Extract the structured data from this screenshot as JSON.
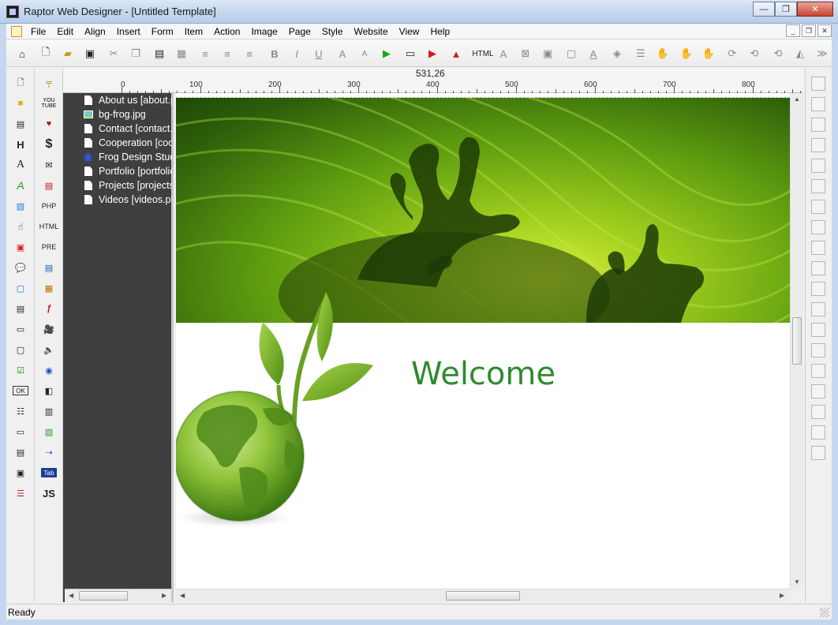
{
  "window": {
    "title": "Raptor Web Designer - [Untitled Template]",
    "minimize_glyph": "—",
    "maximize_glyph": "❐",
    "close_glyph": "✕"
  },
  "menu": {
    "items": [
      "File",
      "Edit",
      "Align",
      "Insert",
      "Form",
      "Item",
      "Action",
      "Image",
      "Page",
      "Style",
      "Website",
      "View",
      "Help"
    ],
    "mdi_minimize": "_",
    "mdi_restore": "❐",
    "mdi_close": "✕"
  },
  "toolbar": {
    "html_label": "HTML",
    "icons": [
      "new-page-icon",
      "new-template-icon",
      "open-folder-icon",
      "save-icon",
      "cut-icon",
      "copy-icon",
      "paste-icon",
      "paste-special-icon",
      "align-left-icon",
      "align-center-icon",
      "align-right-icon",
      "bold-icon",
      "italic-icon",
      "underline-icon",
      "font-grow-icon",
      "font-shrink-icon",
      "preview-icon",
      "preview-browser-icon",
      "publish-icon",
      "upload-icon",
      "html-icon",
      "font-icon",
      "grid-icon",
      "snap-icon",
      "select-icon",
      "text-color-icon",
      "fill-color-icon",
      "line-icon",
      "hand-icon",
      "hand2-icon",
      "hand3-icon",
      "rotate-icon",
      "rotate2-icon",
      "rotate3-icon",
      "flip-icon",
      "more-icon"
    ]
  },
  "palette1": {
    "icons": [
      "page-icon",
      "folder-icon",
      "form-icon",
      "heading-icon",
      "text-icon",
      "styled-text-icon",
      "image-icon",
      "hand-icon",
      "shape-icon",
      "comment-icon",
      "panel-icon",
      "frame-icon",
      "inline-frame-icon",
      "checkbox-icon",
      "ok-button-icon",
      "list-icon",
      "line-icon",
      "textarea-icon",
      "counter-icon",
      "menu-list-icon"
    ],
    "labels": {
      "heading": "H",
      "text": "A",
      "styled": "A",
      "ok": "OK"
    }
  },
  "palette2": {
    "labels": {
      "youtube": "YOU\nTUBE",
      "dollar": "$",
      "php": "PHP",
      "html": "HTML",
      "pre": "PRE",
      "tab": "Tab",
      "js": "JS"
    }
  },
  "ruler": {
    "coordinates": "531,26",
    "labels": [
      "0",
      "100",
      "200",
      "300",
      "400",
      "500",
      "600",
      "700",
      "800"
    ]
  },
  "site_tree": {
    "items": [
      {
        "label": "About us [about.php]",
        "icon": "file-icon"
      },
      {
        "label": "bg-frog.jpg",
        "icon": "image-file-icon"
      },
      {
        "label": "Contact [contact.php]",
        "icon": "file-icon"
      },
      {
        "label": "Cooperation [cooperation.php]",
        "icon": "file-icon"
      },
      {
        "label": "Frog Design Studio",
        "icon": "home-icon"
      },
      {
        "label": "Portfolio [portfolio.php]",
        "icon": "file-icon"
      },
      {
        "label": "Projects [projects.php]",
        "icon": "file-icon"
      },
      {
        "label": "Videos [videos.php]",
        "icon": "file-icon"
      }
    ]
  },
  "canvas": {
    "welcome_text": "Welcome",
    "colors": {
      "welcome": "#2e8b2e",
      "hero_light": "#d9f03a",
      "hero_dark": "#1f4806"
    }
  },
  "status": {
    "text": "Ready"
  }
}
